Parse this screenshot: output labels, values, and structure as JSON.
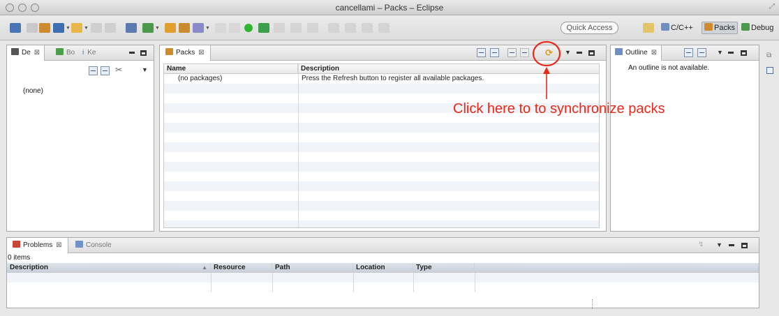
{
  "window": {
    "title": "cancellami – Packs – Eclipse"
  },
  "toolbar": {
    "quick_access": "Quick Access",
    "perspectives": [
      {
        "label": "C/C++",
        "icon": "cpp-perspective-icon",
        "active": false
      },
      {
        "label": "Packs",
        "icon": "packs-perspective-icon",
        "active": true
      },
      {
        "label": "Debug",
        "icon": "debug-perspective-icon",
        "active": false
      }
    ]
  },
  "left_panel": {
    "tabs": [
      {
        "label": "De",
        "icon": "devices-icon",
        "selected": true
      },
      {
        "label": "Bo",
        "icon": "boards-icon",
        "selected": false
      },
      {
        "label": "Ke",
        "icon": "keywords-icon",
        "selected": false
      }
    ],
    "content": "(none)"
  },
  "packs_panel": {
    "tab_label": "Packs",
    "columns": [
      "Name",
      "Description"
    ],
    "rows": [
      {
        "name": "(no packages)",
        "description": "Press the Refresh button to register all available packages."
      }
    ]
  },
  "outline_panel": {
    "tab_label": "Outline",
    "message": "An outline is not available."
  },
  "bottom_panel": {
    "tabs": [
      {
        "label": "Problems",
        "icon": "problems-icon",
        "selected": true
      },
      {
        "label": "Console",
        "icon": "console-icon",
        "selected": false
      }
    ],
    "item_count": "0 items",
    "columns": [
      "Description",
      "Resource",
      "Path",
      "Location",
      "Type"
    ]
  },
  "annotation": {
    "text": "Click here to to synchronize packs",
    "color": "#e8291a"
  },
  "colors": {
    "accent": "#e8291a",
    "selection": "#cfd3da",
    "row_alt": "#f0f3f7"
  }
}
